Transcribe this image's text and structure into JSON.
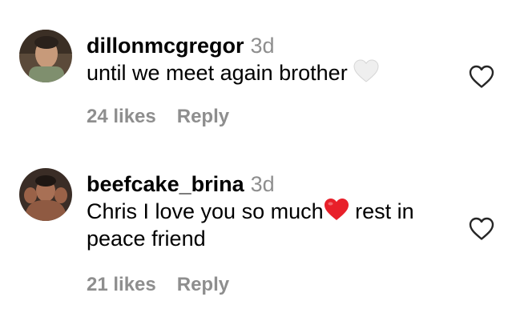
{
  "comments": [
    {
      "username": "dillonmcgregor",
      "time": "3d",
      "text_before_emoji": "until we meet again brother ",
      "emoji": "white-heart",
      "text_after_emoji": "",
      "likes": "24 likes",
      "reply_label": "Reply"
    },
    {
      "username": "beefcake_brina",
      "time": "3d",
      "text_before_emoji": "Chris I love you so much",
      "emoji": "red-heart",
      "text_after_emoji": " rest in peace friend",
      "likes": "21 likes",
      "reply_label": "Reply"
    }
  ],
  "colors": {
    "text": "#000000",
    "secondary": "#8e8e8e",
    "red_heart": "#e8202a",
    "white_heart": "#efefef"
  }
}
